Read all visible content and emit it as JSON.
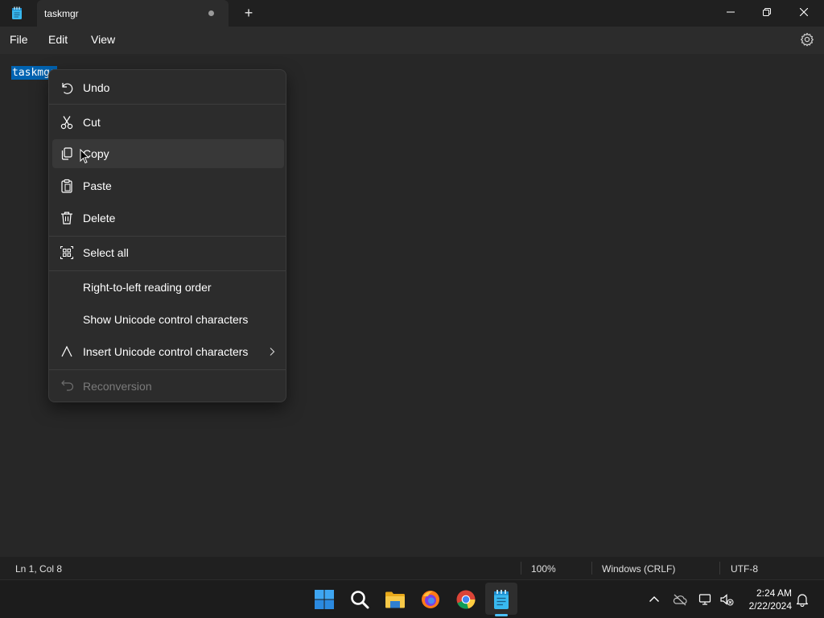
{
  "window": {
    "tab_title": "taskmgr",
    "new_tab": "+"
  },
  "menu": {
    "file": "File",
    "edit": "Edit",
    "view": "View"
  },
  "editor": {
    "content": "taskmgr",
    "selected": true
  },
  "context_menu": {
    "items": [
      {
        "label": "Undo",
        "icon": "undo-icon",
        "enabled": true
      },
      {
        "label": "Cut",
        "icon": "scissors-icon",
        "enabled": true
      },
      {
        "label": "Copy",
        "icon": "copy-icon",
        "enabled": true,
        "hovered": true
      },
      {
        "label": "Paste",
        "icon": "clipboard-icon",
        "enabled": true
      },
      {
        "label": "Delete",
        "icon": "trash-icon",
        "enabled": true
      },
      {
        "label": "Select all",
        "icon": "select-all-icon",
        "enabled": true
      },
      {
        "label": "Right-to-left reading order",
        "icon": "",
        "enabled": true
      },
      {
        "label": "Show Unicode control characters",
        "icon": "",
        "enabled": true
      },
      {
        "label": "Insert Unicode control characters",
        "icon": "caret-icon",
        "enabled": true,
        "submenu": true
      },
      {
        "label": "Reconversion",
        "icon": "reconversion-icon",
        "enabled": false
      }
    ]
  },
  "status": {
    "position": "Ln 1, Col 8",
    "zoom": "100%",
    "line_ending": "Windows (CRLF)",
    "encoding": "UTF-8"
  },
  "taskbar": {
    "apps": [
      "windows-start-icon",
      "search-icon",
      "file-explorer-icon",
      "firefox-icon",
      "chrome-icon",
      "notepad-icon"
    ],
    "active_app": "notepad-icon",
    "time": "2:24 AM",
    "date": "2/22/2024"
  },
  "colors": {
    "selection": "#0063b1",
    "accent": "#4cc2ff",
    "background": "#272727"
  }
}
